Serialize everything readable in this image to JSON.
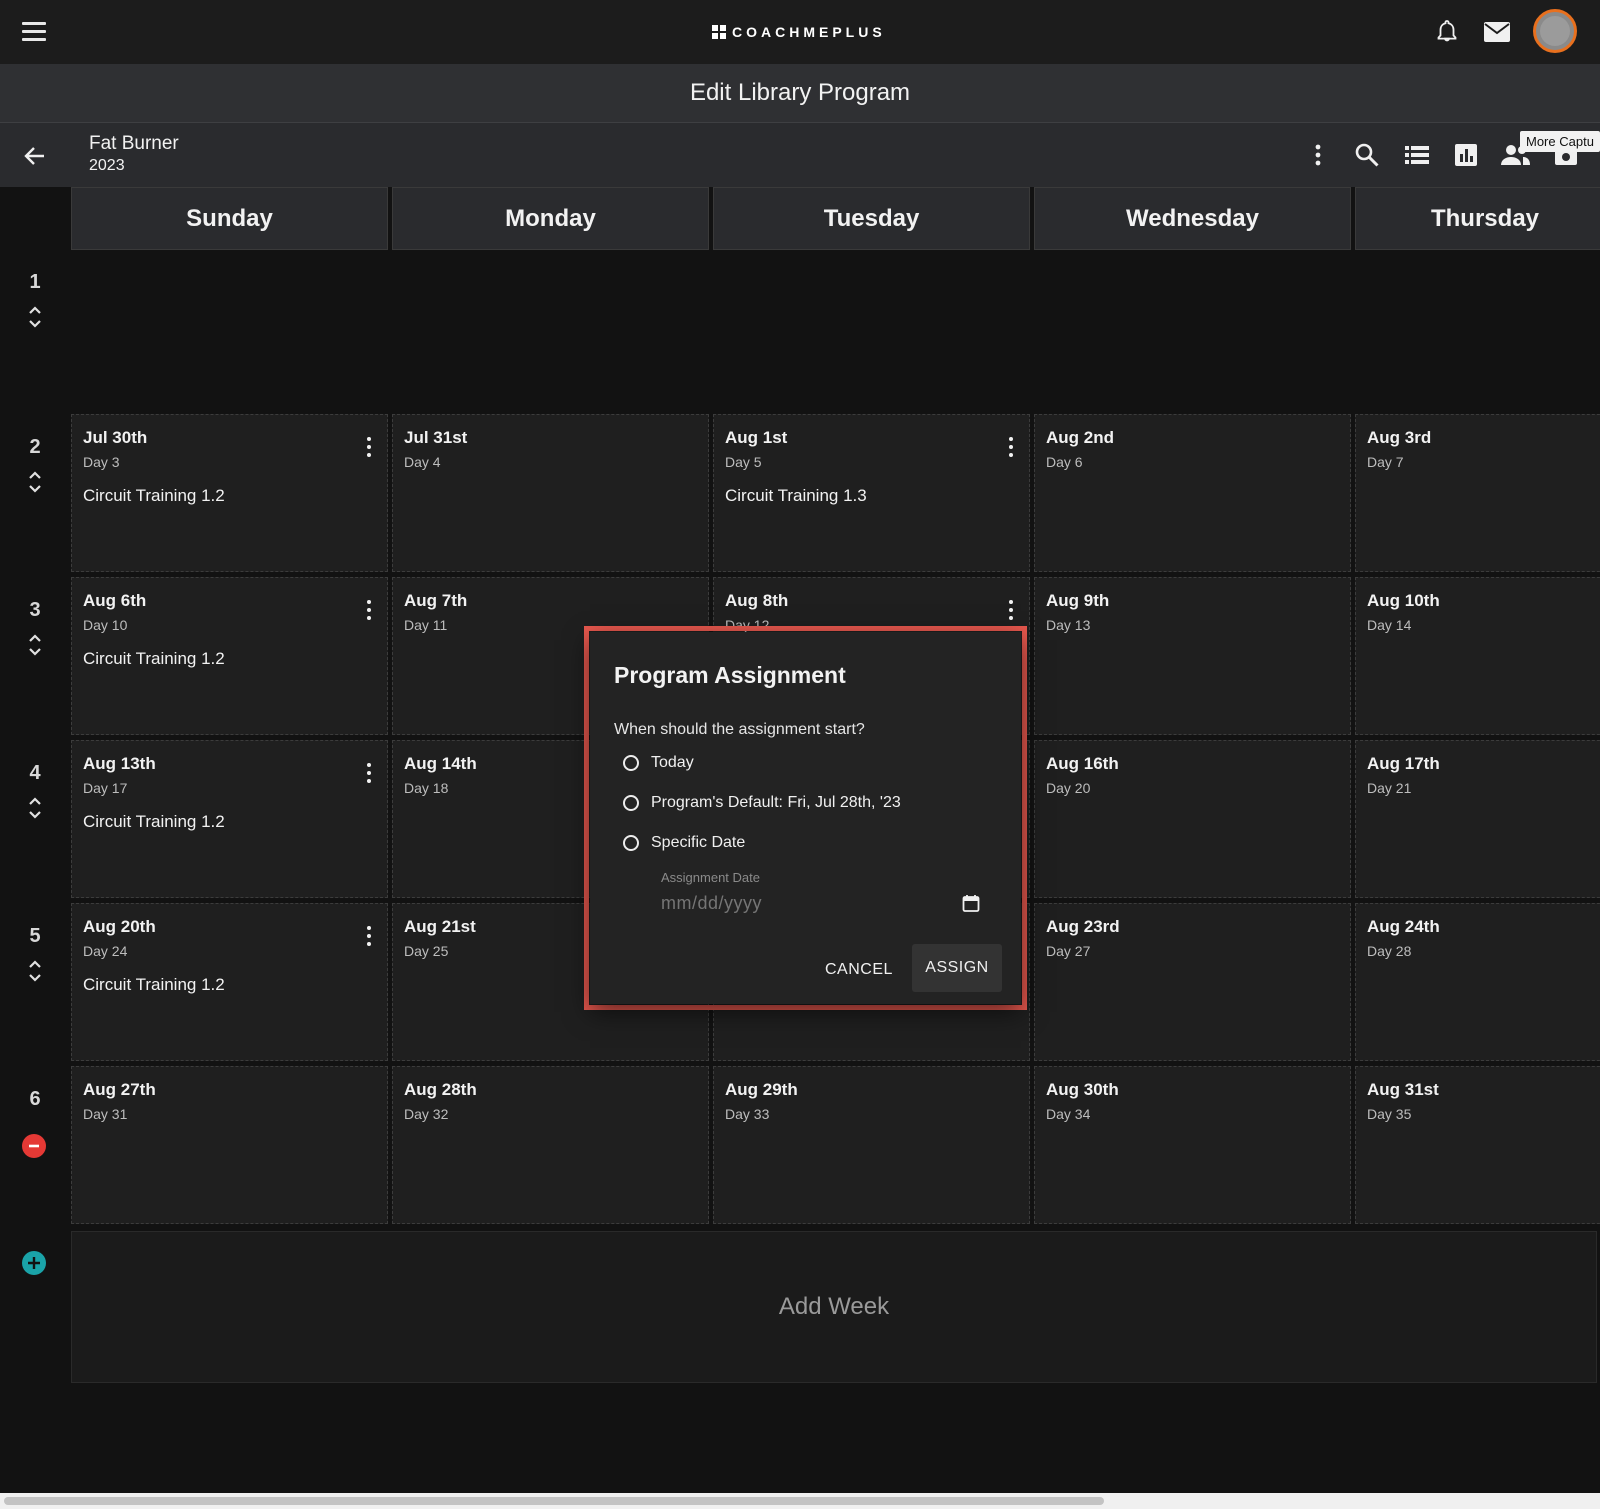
{
  "topbar": {
    "logo_text": "COACHMEPLUS",
    "icons": [
      "menu-icon",
      "bell-icon",
      "mail-icon",
      "avatar"
    ]
  },
  "title": "Edit Library Program",
  "program": {
    "name": "Fat Burner",
    "year": "2023",
    "tooltip": "More Captu"
  },
  "toolbar_icons": [
    "more-vert-icon",
    "search-icon",
    "list-view-icon",
    "chart-icon",
    "people-icon",
    "capture-icon"
  ],
  "days": [
    "Sunday",
    "Monday",
    "Tuesday",
    "Wednesday",
    "Thursday"
  ],
  "weeks": [
    {
      "num": "1",
      "cells": []
    },
    {
      "num": "2",
      "cells": [
        {
          "date": "Jul 30th",
          "day": "Day 3",
          "workout": "Circuit Training 1.2",
          "menu": true
        },
        {
          "date": "Jul 31st",
          "day": "Day 4",
          "workout": "",
          "menu": false
        },
        {
          "date": "Aug 1st",
          "day": "Day 5",
          "workout": "Circuit Training 1.3",
          "menu": true
        },
        {
          "date": "Aug 2nd",
          "day": "Day 6",
          "workout": "",
          "menu": false
        },
        {
          "date": "Aug 3rd",
          "day": "Day 7",
          "workout": "",
          "menu": false
        }
      ]
    },
    {
      "num": "3",
      "cells": [
        {
          "date": "Aug 6th",
          "day": "Day 10",
          "workout": "Circuit Training 1.2",
          "menu": true
        },
        {
          "date": "Aug 7th",
          "day": "Day 11",
          "workout": "",
          "menu": false
        },
        {
          "date": "Aug 8th",
          "day": "Day 12",
          "workout": "",
          "menu": true
        },
        {
          "date": "Aug 9th",
          "day": "Day 13",
          "workout": "",
          "menu": false
        },
        {
          "date": "Aug 10th",
          "day": "Day 14",
          "workout": "",
          "menu": false
        }
      ]
    },
    {
      "num": "4",
      "cells": [
        {
          "date": "Aug 13th",
          "day": "Day 17",
          "workout": "Circuit Training 1.2",
          "menu": true
        },
        {
          "date": "Aug 14th",
          "day": "Day 18",
          "workout": "",
          "menu": false
        },
        {
          "date": "",
          "day": "",
          "workout": "",
          "menu": false
        },
        {
          "date": "Aug 16th",
          "day": "Day 20",
          "workout": "",
          "menu": false
        },
        {
          "date": "Aug 17th",
          "day": "Day 21",
          "workout": "",
          "menu": false
        }
      ]
    },
    {
      "num": "5",
      "cells": [
        {
          "date": "Aug 20th",
          "day": "Day 24",
          "workout": "Circuit Training 1.2",
          "menu": true
        },
        {
          "date": "Aug 21st",
          "day": "Day 25",
          "workout": "",
          "menu": false
        },
        {
          "date": "",
          "day": "",
          "workout": "",
          "menu": false
        },
        {
          "date": "Aug 23rd",
          "day": "Day 27",
          "workout": "",
          "menu": false
        },
        {
          "date": "Aug 24th",
          "day": "Day 28",
          "workout": "",
          "menu": false
        }
      ]
    },
    {
      "num": "6",
      "cells": [
        {
          "date": "Aug 27th",
          "day": "Day 31",
          "workout": "",
          "menu": false
        },
        {
          "date": "Aug 28th",
          "day": "Day 32",
          "workout": "",
          "menu": false
        },
        {
          "date": "Aug 29th",
          "day": "Day 33",
          "workout": "",
          "menu": false
        },
        {
          "date": "Aug 30th",
          "day": "Day 34",
          "workout": "",
          "menu": false
        },
        {
          "date": "Aug 31st",
          "day": "Day 35",
          "workout": "",
          "menu": false
        }
      ]
    }
  ],
  "add_week_label": "Add Week",
  "dialog": {
    "title": "Program Assignment",
    "question": "When should the assignment start?",
    "options": [
      "Today",
      "Program's Default: Fri, Jul 28th, '23",
      "Specific Date"
    ],
    "date_label": "Assignment Date",
    "date_placeholder": "mm/dd/yyyy",
    "date_value": "",
    "cancel_label": "CANCEL",
    "assign_label": "ASSIGN"
  },
  "colors": {
    "background": "#121212",
    "highlight": "#e8584e",
    "avatar_ring": "#e8701e",
    "remove_week": "#e53935",
    "add_week": "#1aa3a8"
  }
}
